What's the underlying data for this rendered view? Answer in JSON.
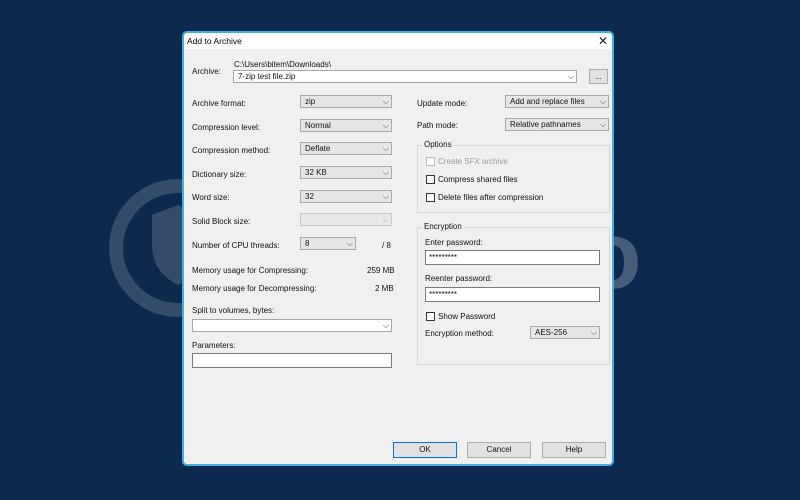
{
  "dialog": {
    "title": "Add to Archive",
    "close_glyph": "✕"
  },
  "archive": {
    "label": "Archive:",
    "path": "C:\\Users\\bitem\\Downloads\\",
    "filename": "7-zip test file.zip",
    "browse_label": "..."
  },
  "left": {
    "archive_format": {
      "label": "Archive format:",
      "value": "zip"
    },
    "compression_level": {
      "label": "Compression level:",
      "value": "Normal"
    },
    "compression_method": {
      "label": "Compression method:",
      "value": "Deflate"
    },
    "dictionary_size": {
      "label": "Dictionary size:",
      "value": "32 KB"
    },
    "word_size": {
      "label": "Word size:",
      "value": "32"
    },
    "solid_block_size": {
      "label": "Solid Block size:",
      "value": ""
    },
    "cpu_threads": {
      "label": "Number of CPU threads:",
      "value": "8",
      "total": "/ 8"
    },
    "mem_compress": {
      "label": "Memory usage for Compressing:",
      "value": "259 MB"
    },
    "mem_decompress": {
      "label": "Memory usage for Decompressing:",
      "value": "2 MB"
    },
    "split_volumes": {
      "label": "Split to volumes, bytes:",
      "value": ""
    },
    "parameters": {
      "label": "Parameters:",
      "value": ""
    }
  },
  "right": {
    "update_mode": {
      "label": "Update mode:",
      "value": "Add and replace files"
    },
    "path_mode": {
      "label": "Path mode:",
      "value": "Relative pathnames"
    },
    "options": {
      "title": "Options",
      "create_sfx": "Create SFX archive",
      "compress_shared": "Compress shared files",
      "delete_after": "Delete files after compression"
    },
    "encryption": {
      "title": "Encryption",
      "enter_password_label": "Enter password:",
      "enter_password_value": "*********",
      "reenter_password_label": "Reenter password:",
      "reenter_password_value": "*********",
      "show_password": "Show Password",
      "method_label": "Encryption method:",
      "method_value": "AES-256"
    }
  },
  "buttons": {
    "ok": "OK",
    "cancel": "Cancel",
    "help": "Help"
  },
  "icons": {
    "chevron": "⌵"
  },
  "watermark": {
    "text": "Safelyo"
  },
  "colors": {
    "background": "#0d2a4e",
    "dialog_border": "#3fb0df",
    "default_button_border": "#0078d7"
  }
}
